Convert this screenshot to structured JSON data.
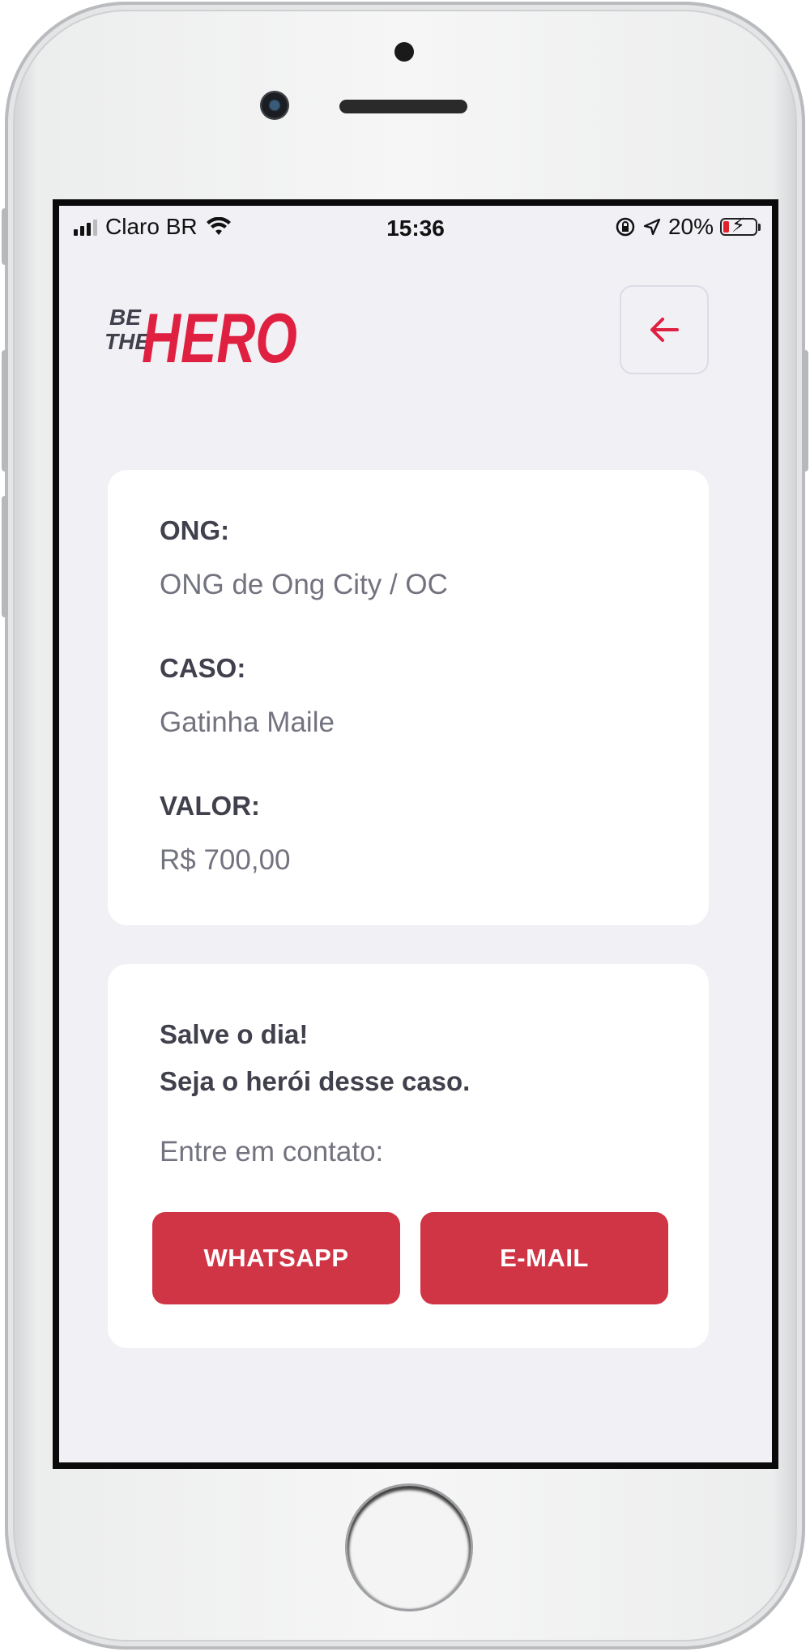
{
  "status_bar": {
    "carrier": "Claro BR",
    "time": "15:36",
    "battery": "20%"
  },
  "header": {
    "logo_text_small_1": "BE",
    "logo_text_small_2": "THE",
    "logo_text_big": "HERO"
  },
  "incident": {
    "ong_label": "ONG:",
    "ong_value": "ONG de Ong City / OC",
    "case_label": "CASO:",
    "case_value": "Gatinha Maile",
    "value_label": "VALOR:",
    "value_value": "R$ 700,00"
  },
  "contact": {
    "title_line1": "Salve o dia!",
    "title_line2": "Seja o herói desse caso.",
    "description": "Entre em contato:",
    "whatsapp_label": "WHATSAPP",
    "email_label": "E-MAIL"
  },
  "colors": {
    "accent": "#E02041",
    "background": "#F0F0F5",
    "card": "#FFFFFF",
    "text_dark": "#41414D",
    "text_light": "#737380"
  },
  "icons": {
    "back": "arrow-left-icon",
    "wifi": "wifi-icon",
    "lock": "orientation-lock-icon",
    "location": "location-arrow-icon",
    "battery": "battery-charging-icon"
  }
}
